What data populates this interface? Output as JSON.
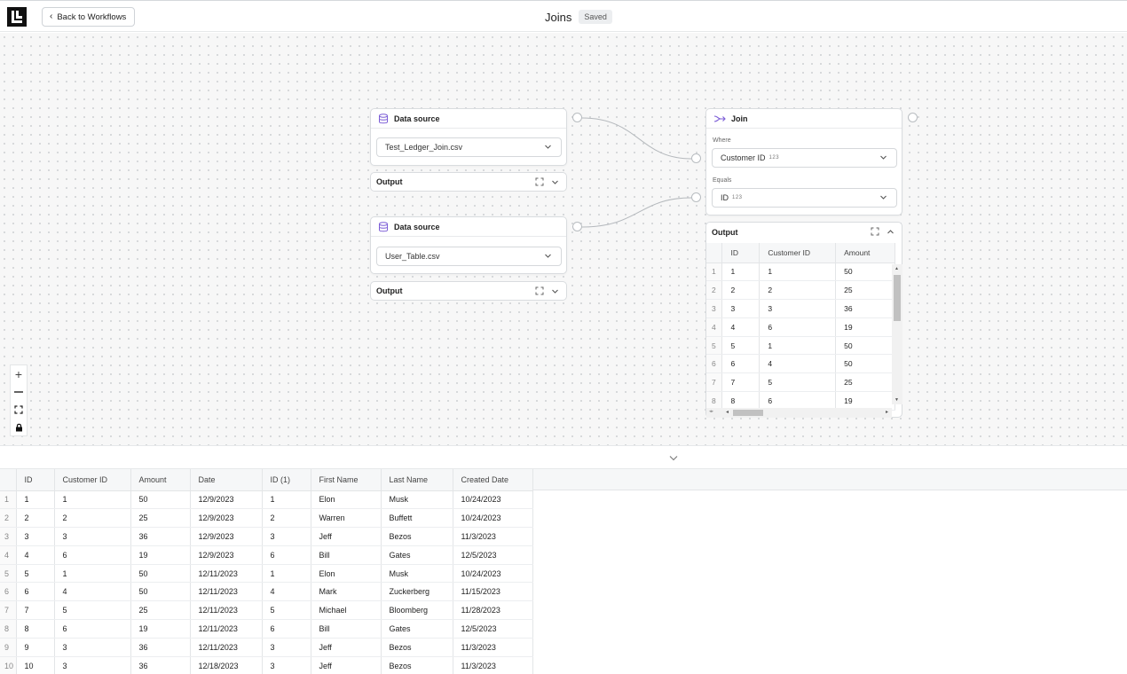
{
  "header": {
    "back_label": "Back to Workflows",
    "title": "Joins",
    "status": "Saved"
  },
  "colors": {
    "accent": "#7b5cd6"
  },
  "nodes": {
    "source1": {
      "title": "Data source",
      "file": "Test_Ledger_Join.csv",
      "output_label": "Output"
    },
    "source2": {
      "title": "Data source",
      "file": "User_Table.csv",
      "output_label": "Output"
    },
    "join": {
      "title": "Join",
      "where_label": "Where",
      "where_value": "Customer ID",
      "where_type": "123",
      "equals_label": "Equals",
      "equals_value": "ID",
      "equals_type": "123",
      "output_label": "Output"
    }
  },
  "join_output": {
    "columns": [
      "ID",
      "Customer ID",
      "Amount"
    ],
    "rows": [
      [
        "1",
        "1",
        "1",
        "50"
      ],
      [
        "2",
        "2",
        "2",
        "25"
      ],
      [
        "3",
        "3",
        "3",
        "36"
      ],
      [
        "4",
        "4",
        "6",
        "19"
      ],
      [
        "5",
        "5",
        "1",
        "50"
      ],
      [
        "6",
        "6",
        "4",
        "50"
      ],
      [
        "7",
        "7",
        "5",
        "25"
      ],
      [
        "8",
        "8",
        "6",
        "19"
      ]
    ]
  },
  "results": {
    "columns": [
      "ID",
      "Customer ID",
      "Amount",
      "Date",
      "ID (1)",
      "First Name",
      "Last Name",
      "Created Date"
    ],
    "rows": [
      [
        "1",
        "1",
        "1",
        "50",
        "12/9/2023",
        "1",
        "Elon",
        "Musk",
        "10/24/2023"
      ],
      [
        "2",
        "2",
        "2",
        "25",
        "12/9/2023",
        "2",
        "Warren",
        "Buffett",
        "10/24/2023"
      ],
      [
        "3",
        "3",
        "3",
        "36",
        "12/9/2023",
        "3",
        "Jeff",
        "Bezos",
        "11/3/2023"
      ],
      [
        "4",
        "4",
        "6",
        "19",
        "12/9/2023",
        "6",
        "Bill",
        "Gates",
        "12/5/2023"
      ],
      [
        "5",
        "5",
        "1",
        "50",
        "12/11/2023",
        "1",
        "Elon",
        "Musk",
        "10/24/2023"
      ],
      [
        "6",
        "6",
        "4",
        "50",
        "12/11/2023",
        "4",
        "Mark",
        "Zuckerberg",
        "11/15/2023"
      ],
      [
        "7",
        "7",
        "5",
        "25",
        "12/11/2023",
        "5",
        "Michael",
        "Bloomberg",
        "11/28/2023"
      ],
      [
        "8",
        "8",
        "6",
        "19",
        "12/11/2023",
        "6",
        "Bill",
        "Gates",
        "12/5/2023"
      ],
      [
        "9",
        "9",
        "3",
        "36",
        "12/11/2023",
        "3",
        "Jeff",
        "Bezos",
        "11/3/2023"
      ],
      [
        "10",
        "10",
        "3",
        "36",
        "12/18/2023",
        "3",
        "Jeff",
        "Bezos",
        "11/3/2023"
      ]
    ]
  },
  "icons": {
    "logo": "logo-icon",
    "back": "chevron-left-icon",
    "source": "database-icon",
    "join": "join-arrow-icon",
    "expand": "expand-icon",
    "dropdown": "chevron-down-icon",
    "zoom_in": "plus-icon",
    "zoom_out": "minus-icon",
    "fit": "fit-view-icon",
    "lock": "lock-icon"
  }
}
